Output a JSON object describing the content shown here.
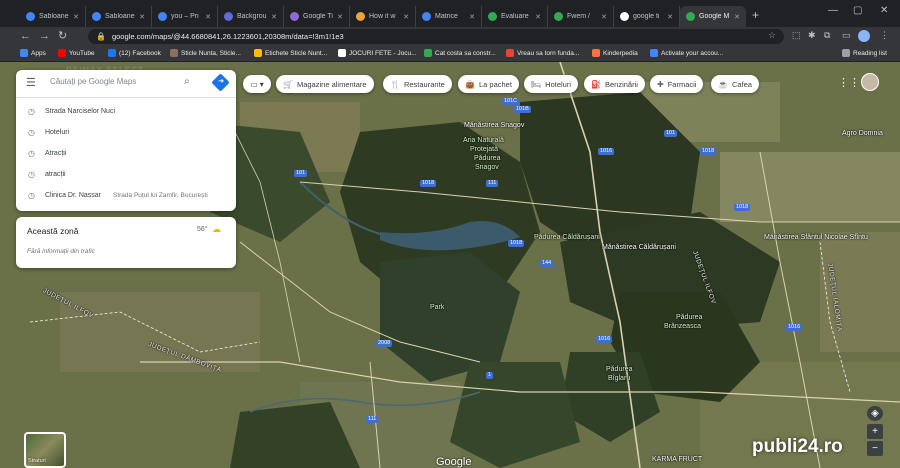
{
  "tabs": [
    {
      "title": "Sabloane",
      "color": "#4285f4"
    },
    {
      "title": "Sabloane",
      "color": "#4285f4"
    },
    {
      "title": "you – Pri",
      "color": "#4285f4"
    },
    {
      "title": "Backgrou",
      "color": "#5f6bd6"
    },
    {
      "title": "Google Ti",
      "color": "#8c6bd6"
    },
    {
      "title": "How it w",
      "color": "#e8a33d"
    },
    {
      "title": "Matrice",
      "color": "#4285f4"
    },
    {
      "title": "Evaluare",
      "color": "#34a853"
    },
    {
      "title": "Fwem /",
      "color": "#34a853"
    },
    {
      "title": "google ti",
      "color": "#ffffff"
    },
    {
      "title": "Google M",
      "color": "#34a853"
    }
  ],
  "toolbar": {
    "url": "google.com/maps/@44.6680841,26.1223601,20308m/data=!3m1!1e3"
  },
  "bookmarks": [
    {
      "label": "Apps",
      "color": "#4285f4"
    },
    {
      "label": "YouTube",
      "color": "#ff0000"
    },
    {
      "label": "(12) Facebook",
      "color": "#1877f2"
    },
    {
      "label": "Sticle Nunta, Sticle...",
      "color": "#8d6e63"
    },
    {
      "label": "Etichete Sticle Nunt...",
      "color": "#fbbc04"
    },
    {
      "label": "JOCURI FETE - Jocu...",
      "color": "#ffffff"
    },
    {
      "label": "Cat costa sa constr...",
      "color": "#34a853"
    },
    {
      "label": "Vreau sa torn funda...",
      "color": "#ea4335"
    },
    {
      "label": "Kinderpedia",
      "color": "#ff7043"
    },
    {
      "label": "Activate your accou...",
      "color": "#4285f4"
    }
  ],
  "reading_list": "Reading list",
  "search": {
    "placeholder": "Căutați pe Google Maps",
    "suggestions": [
      {
        "label": "Strada Narciselor Nuci",
        "sub": ""
      },
      {
        "label": "Hoteluri",
        "sub": ""
      },
      {
        "label": "Atracții",
        "sub": ""
      },
      {
        "label": "atracții",
        "sub": ""
      },
      {
        "label": "Clinica Dr. Nassar",
        "sub": "Strada Puțul lui Zamfir, București"
      }
    ]
  },
  "area": {
    "title": "Această zonă",
    "temp": "56°",
    "traffic": "Fără informații din trafic"
  },
  "chips": [
    {
      "label": "Magazine alimentare",
      "icon": "cart-icon"
    },
    {
      "label": "Restaurante",
      "icon": "fork-knife-icon"
    },
    {
      "label": "La pachet",
      "icon": "bag-icon"
    },
    {
      "label": "Hoteluri",
      "icon": "bed-icon"
    },
    {
      "label": "Benzinării",
      "icon": "fuel-icon"
    },
    {
      "label": "Farmacii",
      "icon": "pharmacy-icon"
    },
    {
      "label": "Cafea",
      "icon": "coffee-icon"
    }
  ],
  "map": {
    "labels": [
      {
        "text": "Mănăstirea Snagov"
      },
      {
        "text": "Aria Naturală"
      },
      {
        "text": "Protejată"
      },
      {
        "text": "Pădurea"
      },
      {
        "text": "Snagov"
      },
      {
        "text": "Pădurea Căldărușani"
      },
      {
        "text": "Mănăstirea Căldărușani"
      },
      {
        "text": "Mănăstirea Sfântul Nicolae Sfîntu"
      },
      {
        "text": "Pădurea"
      },
      {
        "text": "Brănzeasca"
      },
      {
        "text": "Pădurea"
      },
      {
        "text": "Bîglaru"
      },
      {
        "text": "JUDEȚUL ILFOV"
      },
      {
        "text": "JUDEȚUL DÂMBOVIȚA"
      },
      {
        "text": "JUDEȚUL IALOMIȚA"
      },
      {
        "text": "JUDEȚUL ILFOV"
      },
      {
        "text": "Agro Domnia"
      },
      {
        "text": "KARMA FRUCT"
      },
      {
        "text": "Park"
      }
    ],
    "roads": [
      "101C",
      "101",
      "1016",
      "1018",
      "111",
      "1018",
      "144",
      "2008",
      "1",
      "111",
      "1016",
      "1018",
      "101",
      "1018",
      "101B",
      "1016"
    ],
    "watermark": "RE/MAX SELECT",
    "layer_label": "Straturi",
    "google_logo": "Google",
    "site_watermark": "publi24.ro"
  },
  "colors": {
    "accent": "#1a73e8",
    "forest": "#2e3b22",
    "fields": "#6a7048"
  }
}
